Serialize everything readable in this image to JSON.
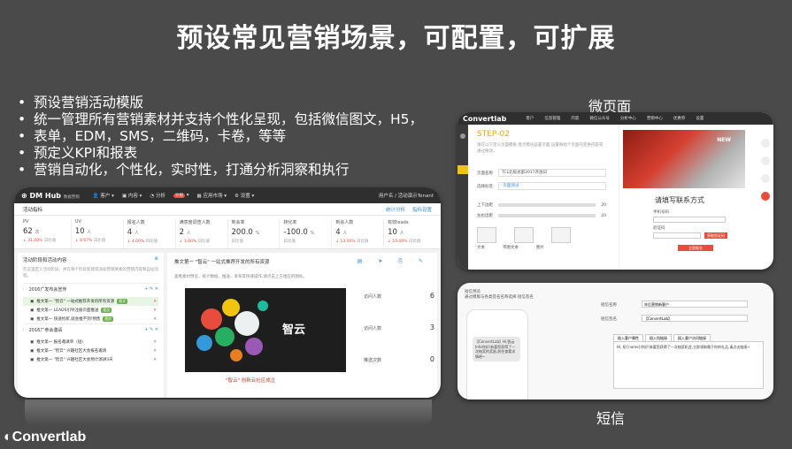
{
  "slide": {
    "title": "预设常见营销场景，可配置，可扩展",
    "bullets": [
      "预设营销活动模版",
      "统一管理所有营销素材并支持个性化呈现，包括微信图文，H5，",
      "表单，EDM，SMS，二维码，卡卷，等等",
      "预定义KPI和报表",
      "营销自动化，个性化，实时性，打通分析洞察和执行"
    ],
    "label_micro": "微页面",
    "label_sms": "短信",
    "footer_logo": "Convertlab"
  },
  "dashboard": {
    "brand": "DM Hub",
    "brand_sub": "数据营销",
    "nav": [
      "客户",
      "内容",
      "分析",
      "计划",
      "应用市场",
      "设置"
    ],
    "nav_badge": "计划",
    "user": "用户名 / 活动演示Tenant",
    "kpi_title": "活动指标",
    "kpi_links": [
      "统计分析",
      "指标设置"
    ],
    "kpis": [
      {
        "name": "PV",
        "value": "62",
        "unit": "次",
        "change": "↓ 31.00%",
        "ref": "日比值"
      },
      {
        "name": "UV",
        "value": "10",
        "unit": "人",
        "change": "↓ 8.67%",
        "ref": "日比值"
      },
      {
        "name": "报名人数",
        "value": "4",
        "unit": "人",
        "change": "↓ 4.00%",
        "ref": "日比值"
      },
      {
        "name": "满意度调查人数",
        "value": "2",
        "unit": "人",
        "change": "↓ 3.00%",
        "ref": "日比值"
      },
      {
        "name": "到会率",
        "value": "200.0",
        "unit": "%",
        "change": "",
        "ref": "日比值"
      },
      {
        "name": "转化率",
        "value": "-100.0",
        "unit": "%",
        "change": "",
        "ref": "日比值"
      },
      {
        "name": "到会人数",
        "value": "4",
        "unit": "人",
        "change": "↓ 13.00%",
        "ref": "日比值"
      },
      {
        "name": "有效leads",
        "value": "10",
        "unit": "人",
        "change": "↓ 10.00%",
        "ref": "日比值"
      }
    ],
    "left_title": "活动阶段和活动内容",
    "left_desc": "在这里定义活动阶段，并在每个阶段新建或添加营销要素的营销内容和自动流程。",
    "groups": [
      {
        "name": "2016广发布会宣传",
        "items": [
          {
            "label": "推文第一 \"智云\" 一站式推荐开发的所有资源",
            "tag": "图文",
            "active": true
          },
          {
            "label": "推文第一 LEADS引导注册页面推送",
            "tag": "图文",
            "active": false
          },
          {
            "label": "推文第一 快速抢新,就会推不到!预售",
            "tag": "图文",
            "active": false
          }
        ]
      },
      {
        "name": "2016广参会邀请",
        "items": [
          {
            "label": "推文第一 报名邀请单（短）",
            "tag": "",
            "active": false
          },
          {
            "label": "推文第一 \"智云\" 兴趣社区大会报名邀请",
            "tag": "",
            "active": false
          },
          {
            "label": "推文第一 \"智云\" 兴趣社区大会预计演讲3天",
            "tag": "",
            "active": false
          }
        ]
      }
    ],
    "right_title": "推文第一 \"智云\" 一站式推荐开发的所有资源",
    "right_desc": "查看素材预览、统计数据、推送、发布等快速操作,请点击上方相应的图标。",
    "cloud_label": "智云",
    "cloud_caption": "\"智云\" 创新云社区成立",
    "stats": [
      {
        "label": "访问人数",
        "value": "6"
      },
      {
        "label": "访问人数",
        "value": "3"
      },
      {
        "label": "推送次数",
        "value": "0"
      }
    ]
  },
  "micro": {
    "logo": "Convertlab",
    "nav": [
      "客户",
      "信息管理",
      "内容",
      "微信公众号",
      "分析中心",
      "营销中心",
      "优惠券",
      "设置"
    ],
    "step": "STEP-02",
    "desc": "请在以下定义页面模板,接点模块设置页面,设置每组个页面的变换内容或通过拖动。",
    "rows": [
      {
        "label": "页面名称",
        "value": "TCL北极总部2017开放日"
      },
      {
        "label": "选择标签",
        "value": "·页面测试"
      }
    ],
    "sliders": [
      "上下边距",
      "左右边距"
    ],
    "slider_vals": [
      "20",
      "20"
    ],
    "icons": [
      "文本",
      "带图文本",
      "图片"
    ],
    "photo_badge": "NEW",
    "form_title": "请填写联系方式",
    "fields": [
      "手机号码",
      "验证码"
    ],
    "code_btn": "获取验证码",
    "submit_btn": "立即报名"
  },
  "sms": {
    "header": [
      "短信预览",
      "通过模版与各类签名名称选择 短信签名"
    ],
    "bubble": "【ConvertLab】Hi,智云 Info你好!恭喜您获得了一次抽奖的奖励,前往查看详情吧~",
    "field_labels": [
      "短信名称",
      "短信签名"
    ],
    "field_values": [
      "年后营销新客户",
      "【ConvertLab】"
    ],
    "tabs": [
      "插入客户属性",
      "插入短链接",
      "插入客户访问链接"
    ],
    "editor": "Hi, 短{name}你好!恭喜您获得了一次抽奖机会,立即领取属于你的礼品,请点击链接~"
  }
}
